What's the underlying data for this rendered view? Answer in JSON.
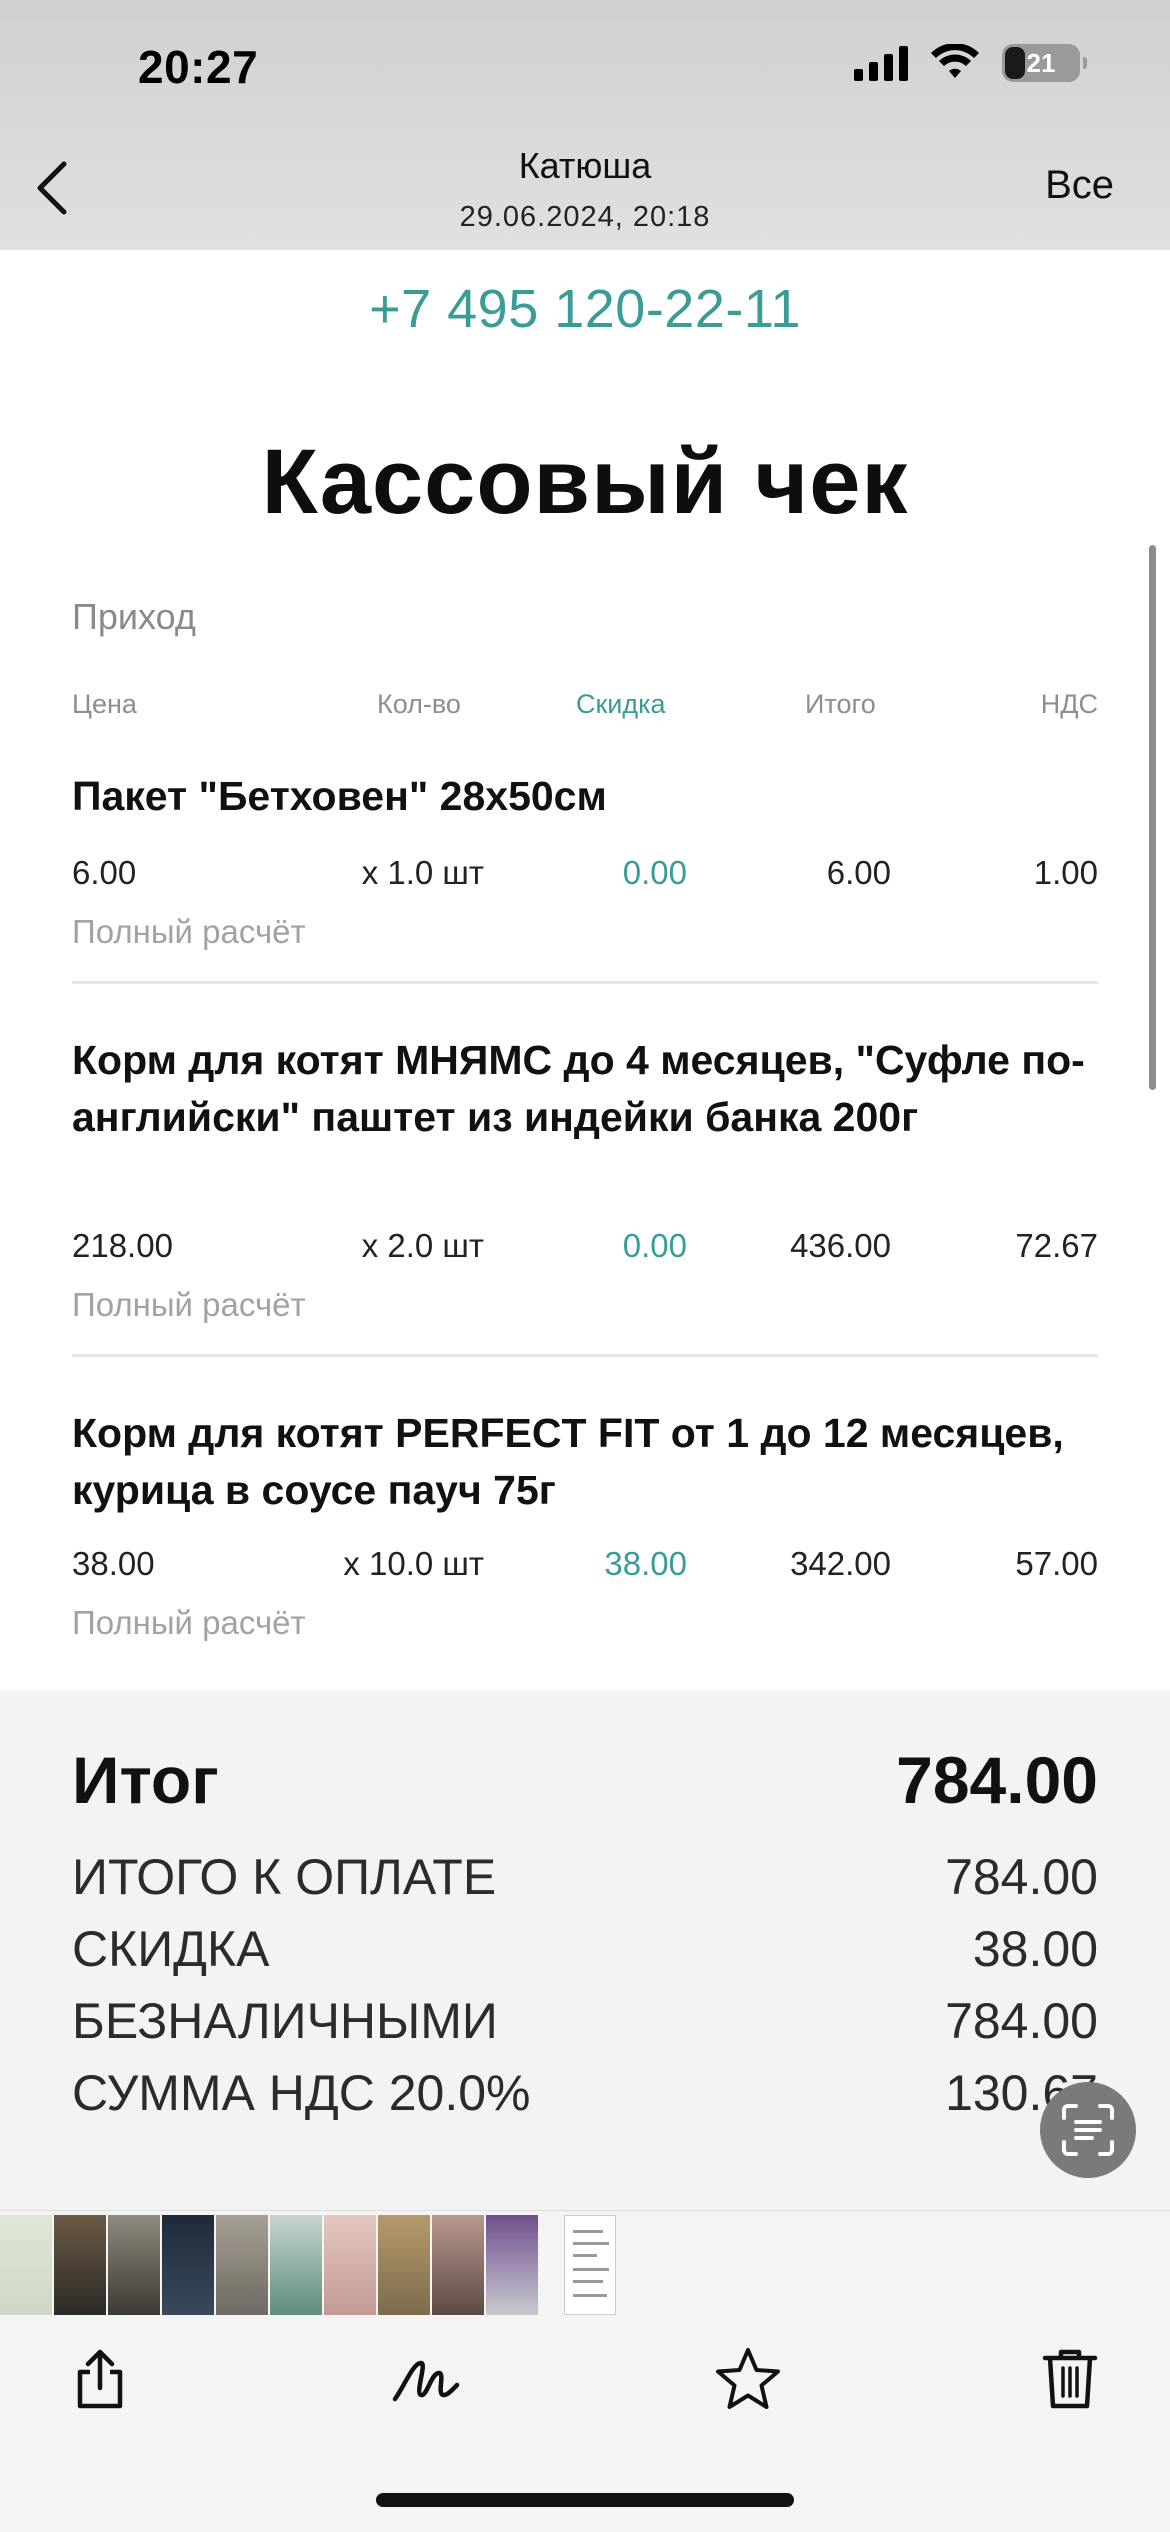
{
  "status_bar": {
    "time": "20:27",
    "battery": "21"
  },
  "nav": {
    "title": "Катюша",
    "subtitle": "29.06.2024, 20:18",
    "all_label": "Все"
  },
  "receipt": {
    "phone": "+7 495 120-22-11",
    "title": "Кассовый чек",
    "operation": "Приход",
    "columns": {
      "price": "Цена",
      "qty": "Кол-во",
      "discount": "Скидка",
      "total": "Итого",
      "vat": "НДС"
    },
    "items": [
      {
        "name": "Пакет \"Бетховен\" 28x50см",
        "price": "6.00",
        "qty": "x 1.0 шт",
        "discount": "0.00",
        "total": "6.00",
        "vat": "1.00",
        "calc": "Полный расчёт"
      },
      {
        "name": "Корм для котят МНЯМС до 4 месяцев, \"Суфле по-английски\" паштет из индейки банка 200г",
        "price": "218.00",
        "qty": "x 2.0 шт",
        "discount": "0.00",
        "total": "436.00",
        "vat": "72.67",
        "calc": "Полный расчёт"
      },
      {
        "name": "Корм для котят PERFECT FIT от 1 до 12 месяцев, курица в соусе пауч 75г",
        "price": "38.00",
        "qty": "x 10.0 шт",
        "discount": "38.00",
        "total": "342.00",
        "vat": "57.00",
        "calc": "Полный расчёт"
      }
    ]
  },
  "totals": {
    "grand_label": "Итог",
    "grand_value": "784.00",
    "rows": [
      {
        "label": "ИТОГО К ОПЛАТЕ",
        "value": "784.00"
      },
      {
        "label": "СКИДКА",
        "value": "38.00"
      },
      {
        "label": "БЕЗНАЛИЧНЫМИ",
        "value": "784.00"
      },
      {
        "label": "СУММА НДС 20.0%",
        "value": "130.67"
      }
    ]
  },
  "toolbar": {
    "icons": [
      "share-icon",
      "markup-icon",
      "favorite-icon",
      "delete-icon"
    ]
  },
  "colors": {
    "accent": "#3a9c97",
    "text": "#111111",
    "muted": "#8e8e8e",
    "panel": "#f3f3f3"
  }
}
